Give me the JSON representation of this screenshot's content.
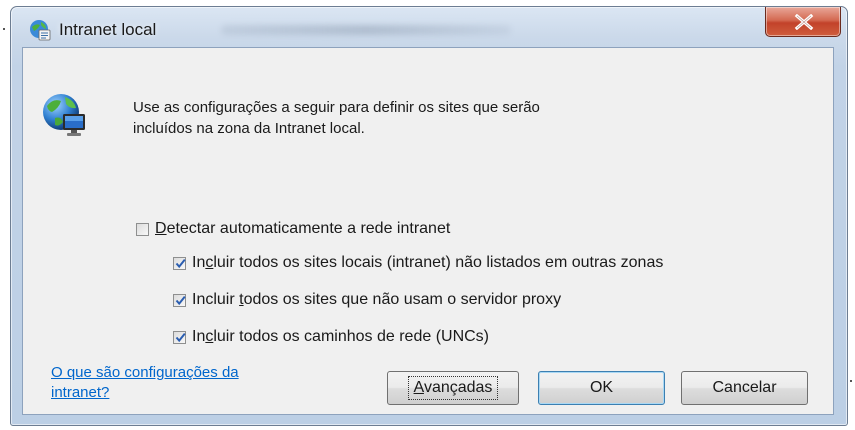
{
  "window": {
    "title": "Intranet local",
    "close_label": "X"
  },
  "description": {
    "line1": "Use as configurações a seguir para definir os sites que serão",
    "line2": "incluídos na zona da Intranet local."
  },
  "options": [
    {
      "pre": "",
      "key": "D",
      "post": "etectar automaticamente a rede intranet",
      "checked": false
    },
    {
      "pre": "In",
      "key": "c",
      "post": "luir todos os sites locais (intranet) não listados em outras zonas",
      "checked": true
    },
    {
      "pre": "Incluir ",
      "key": "t",
      "post": "odos os sites que não usam o servidor proxy",
      "checked": true
    },
    {
      "pre": "In",
      "key": "c",
      "post": "luir todos os caminhos de rede (UNCs)",
      "checked": true
    }
  ],
  "help_link": {
    "line1": "O que são configurações da",
    "line2": "intranet?"
  },
  "buttons": {
    "advanced": {
      "key": "A",
      "rest": "vançadas"
    },
    "ok": "OK",
    "cancel": "Cancelar"
  },
  "colors": {
    "link": "#0066cc",
    "close_button": "#c2422a",
    "check_mark": "#2a5db0"
  }
}
